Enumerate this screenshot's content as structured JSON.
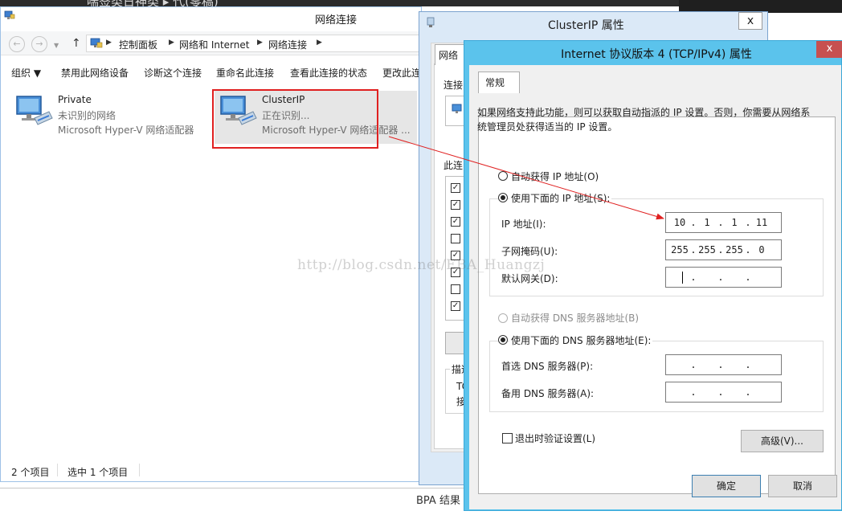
{
  "background": {
    "top_text": "喘签类日神类 ▸ 代(零稿)",
    "bottom_text": "BPA 结果"
  },
  "network_window": {
    "title": "网络连接",
    "address": {
      "crumbs": [
        "控制面板",
        "网络和 Internet",
        "网络连接"
      ]
    },
    "toolbar": [
      "组织 ▼",
      "禁用此网络设备",
      "诊断这个连接",
      "重命名此连接",
      "查看此连接的状态",
      "更改此连"
    ],
    "items": [
      {
        "name": "Private",
        "status": "未识别的网络",
        "adapter": "Microsoft Hyper-V 网络适配器"
      },
      {
        "name": "ClusterIP",
        "status": "正在识别...",
        "adapter": "Microsoft Hyper-V 网络适配器 ..."
      }
    ],
    "status_count": "2 个项目",
    "status_selected": "选中 1 个项目"
  },
  "cluster_dialog": {
    "title": "ClusterIP 属性",
    "close": "x",
    "tab": "网络",
    "connect_label": "连接",
    "items_label": "此连",
    "checks": [
      true,
      true,
      true,
      false,
      true,
      true,
      false,
      true
    ],
    "desc_label": "描述",
    "desc_line1": "TC",
    "desc_line2": "接"
  },
  "ipv4_dialog": {
    "title": "Internet 协议版本 4 (TCP/IPv4) 属性",
    "close": "x",
    "tab": "常规",
    "description": "如果网络支持此功能，则可以获取自动指派的 IP 设置。否则，你需要从网络系统管理员处获得适当的 IP 设置。",
    "radio_auto_ip": "自动获得 IP 地址(O)",
    "radio_manual_ip": "使用下面的 IP 地址(S):",
    "label_ip": "IP 地址(I):",
    "label_mask": "子网掩码(U):",
    "label_gateway": "默认网关(D):",
    "ip": [
      "10",
      "1",
      "1",
      "11"
    ],
    "mask": [
      "255",
      "255",
      "255",
      "0"
    ],
    "gateway": [
      "",
      "",
      "",
      ""
    ],
    "radio_auto_dns": "自动获得 DNS 服务器地址(B)",
    "radio_manual_dns": "使用下面的 DNS 服务器地址(E):",
    "label_dns1": "首选 DNS 服务器(P):",
    "label_dns2": "备用 DNS 服务器(A):",
    "dns1": [
      "",
      "",
      "",
      ""
    ],
    "dns2": [
      "",
      "",
      "",
      ""
    ],
    "checkbox_validate": "退出时验证设置(L)",
    "btn_advanced": "高级(V)...",
    "btn_ok": "确定",
    "btn_cancel": "取消"
  },
  "watermark": "http://blog.csdn.net/EBA_Huangzj",
  "colors": {
    "ipv4_frame": "#5bc3ec",
    "highlight": "#e02020",
    "close_button": "#c75050"
  }
}
